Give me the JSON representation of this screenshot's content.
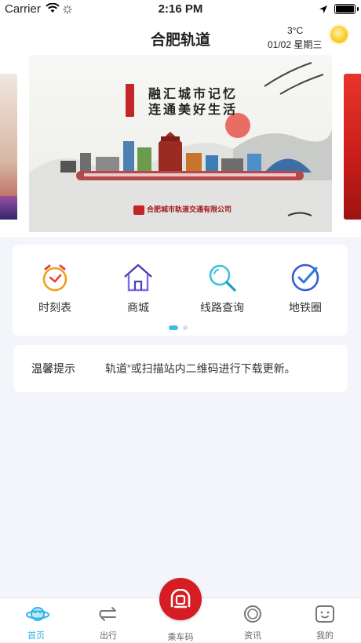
{
  "status": {
    "carrier": "Carrier",
    "time": "2:16 PM"
  },
  "header": {
    "title": "合肥轨道",
    "temperature": "3°C",
    "date": "01/02  星期三",
    "weather_icon": "sunny-icon"
  },
  "banner": {
    "slogan_line1": "融汇城市记忆",
    "slogan_line2": "连通美好生活",
    "company": "合肥城市轨道交通有限公司"
  },
  "menu": {
    "items": [
      {
        "label": "时刻表",
        "icon": "alarm-clock-icon"
      },
      {
        "label": "商城",
        "icon": "house-icon"
      },
      {
        "label": "线路查询",
        "icon": "magnifier-icon"
      },
      {
        "label": "地铁圈",
        "icon": "check-circle-icon"
      }
    ],
    "page_indicator": {
      "current": 1,
      "total": 2
    }
  },
  "notice": {
    "label": "温馨提示",
    "text": "轨道”或扫描站内二维码进行下载更新。"
  },
  "tabbar": {
    "items": [
      {
        "label": "首页",
        "active": true
      },
      {
        "label": "出行",
        "active": false
      },
      {
        "label": "乘车码",
        "active": false
      },
      {
        "label": "资讯",
        "active": false
      },
      {
        "label": "我的",
        "active": false
      }
    ]
  },
  "colors": {
    "accent": "#2fb3e8",
    "brand_red": "#d71d24",
    "background": "#f3f5fb"
  }
}
